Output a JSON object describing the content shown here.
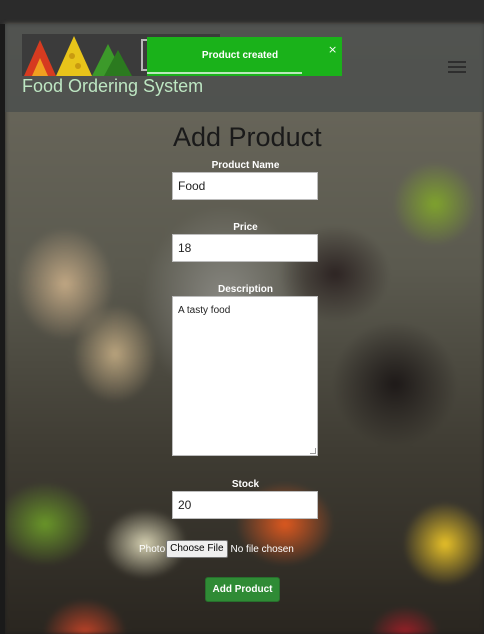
{
  "brand": {
    "logo_text": "SI",
    "name": "Food Ordering System"
  },
  "toast": {
    "message": "Product created",
    "close": "×",
    "color": "#1ab21a"
  },
  "form": {
    "title": "Add Product",
    "product_name": {
      "label": "Product Name",
      "value": "Food"
    },
    "price": {
      "label": "Price",
      "value": "18"
    },
    "description": {
      "label": "Description",
      "value": "A tasty food"
    },
    "stock": {
      "label": "Stock",
      "value": "20"
    },
    "photo": {
      "label": "Photo",
      "button": "Choose File",
      "status": "No file chosen"
    },
    "submit": "Add Product"
  },
  "icons": {
    "menu": "hamburger-menu-icon",
    "close": "close-icon"
  },
  "colors": {
    "submit": "#2f8b35",
    "brand_text": "#bde6c2"
  }
}
